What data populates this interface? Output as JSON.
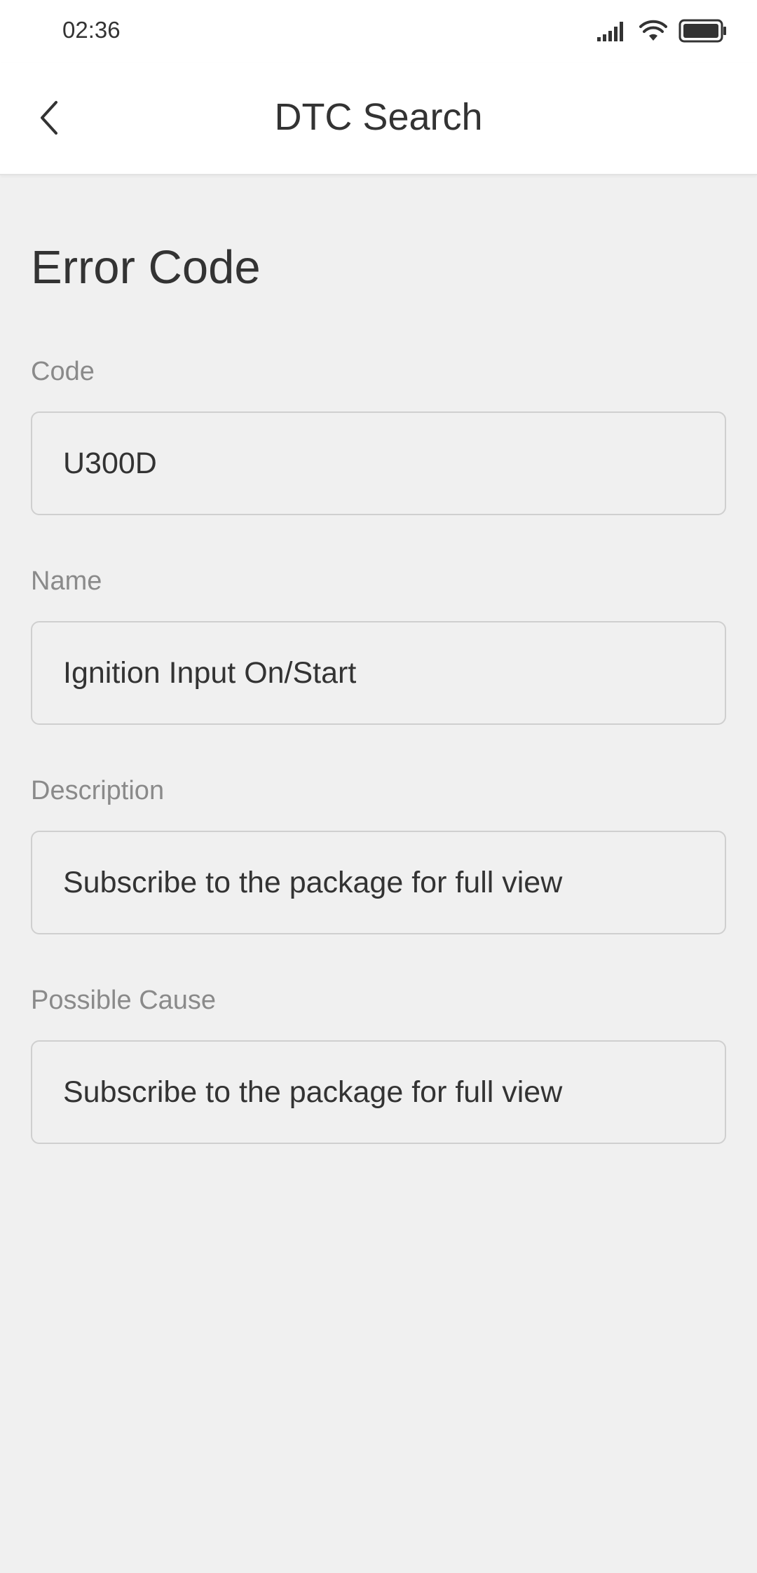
{
  "status_bar": {
    "time": "02:36",
    "icons": [
      "signal-icon",
      "wifi-icon",
      "battery-icon"
    ]
  },
  "app_bar": {
    "title": "DTC Search",
    "back_icon": "chevron-left-icon"
  },
  "section": {
    "title": "Error Code"
  },
  "fields": [
    {
      "label": "Code",
      "value": "U300D"
    },
    {
      "label": "Name",
      "value": "Ignition Input On/Start"
    },
    {
      "label": "Description",
      "value": "Subscribe to the package for full view"
    },
    {
      "label": "Possible Cause",
      "value": "Subscribe to the package for full view"
    }
  ],
  "colors": {
    "background": "#f0f0f0",
    "surface": "#ffffff",
    "text_primary": "#333333",
    "text_label": "#8a8a8a",
    "border": "#cfcfcf"
  }
}
